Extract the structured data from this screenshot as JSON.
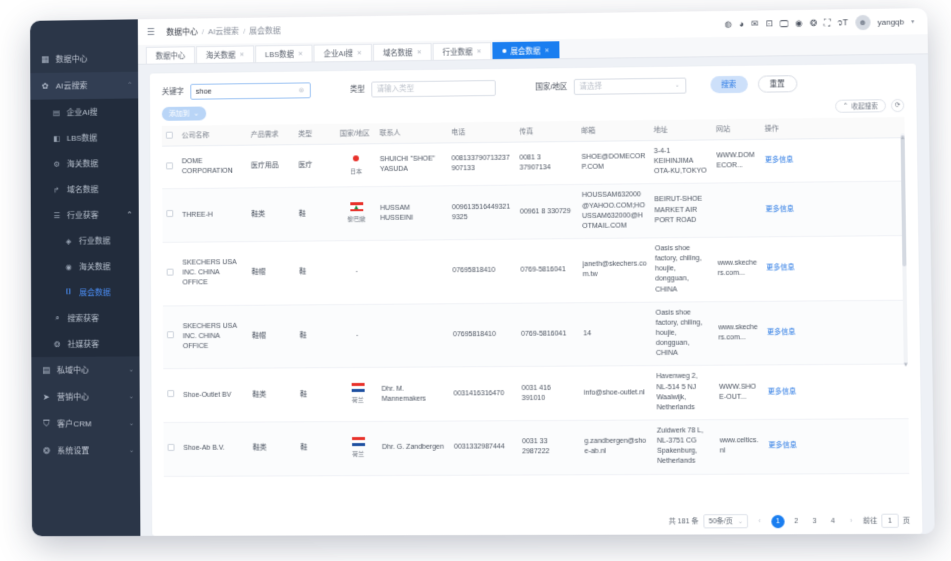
{
  "sidebar": {
    "items": [
      {
        "label": "数据中心",
        "icon": "grid-icon",
        "type": "group"
      },
      {
        "label": "AI云搜索",
        "icon": "gear-icon",
        "type": "group-open",
        "caret": "⌃"
      },
      {
        "label": "企业AI搜",
        "icon": "building-icon",
        "type": "sub"
      },
      {
        "label": "LBS数据",
        "icon": "book-icon",
        "type": "sub"
      },
      {
        "label": "海关数据",
        "icon": "customs-icon",
        "type": "sub"
      },
      {
        "label": "域名数据",
        "icon": "link-icon",
        "type": "sub"
      },
      {
        "label": "行业获客",
        "icon": "list-icon",
        "type": "sub-group-open",
        "caret": "⌃"
      },
      {
        "label": "行业数据",
        "icon": "diamond-icon",
        "type": "sub3"
      },
      {
        "label": "海关数据",
        "icon": "globe-icon",
        "type": "sub3"
      },
      {
        "label": "展会数据",
        "icon": "booth-icon",
        "type": "sub3-selected"
      },
      {
        "label": "搜索获客",
        "icon": "search-icon",
        "type": "sub"
      },
      {
        "label": "社媒获客",
        "icon": "social-icon",
        "type": "sub"
      },
      {
        "label": "私域中心",
        "icon": "stack-icon",
        "type": "group",
        "caret": "⌄"
      },
      {
        "label": "营销中心",
        "icon": "send-icon",
        "type": "group",
        "caret": "⌄"
      },
      {
        "label": "客户CRM",
        "icon": "crm-icon",
        "type": "group",
        "caret": "⌄"
      },
      {
        "label": "系统设置",
        "icon": "settings-globe-icon",
        "type": "group",
        "caret": "⌄"
      }
    ]
  },
  "topbar": {
    "collapse_icon": "menu-fold-icon",
    "breadcrumb": [
      "数据中心",
      "AI云搜索",
      "展会数据"
    ],
    "separator": "/",
    "right_icons": [
      "compass-icon",
      "chat-icon",
      "mail-icon",
      "screenshot-icon",
      "monitor-icon",
      "help-icon",
      "language-icon",
      "fullscreen-icon",
      "font-size-icon"
    ],
    "username": "yangqb",
    "user_caret": "▾"
  },
  "tabs": [
    {
      "label": "数据中心",
      "closable": false,
      "active": false
    },
    {
      "label": "海关数据",
      "closable": true,
      "active": false
    },
    {
      "label": "LBS数据",
      "closable": true,
      "active": false
    },
    {
      "label": "企业AI搜",
      "closable": true,
      "active": false
    },
    {
      "label": "域名数据",
      "closable": true,
      "active": false
    },
    {
      "label": "行业数据",
      "closable": true,
      "active": false
    },
    {
      "label": "展会数据",
      "closable": true,
      "active": true
    }
  ],
  "filters": {
    "keyword_label": "关键字",
    "keyword_value": "shoe",
    "keyword_clear": "⊗",
    "type_label": "类型",
    "type_placeholder": "请输入类型",
    "country_label": "国家/地区",
    "country_placeholder": "请选择",
    "search_button": "搜索",
    "reset_button": "重置"
  },
  "actions": {
    "add_button": "添加到",
    "add_caret": "⌄",
    "collapse_search": "收起搜索",
    "collapse_caret": "⌃",
    "refresh_icon": "refresh-icon"
  },
  "table": {
    "columns": [
      "公司名称",
      "产品需求",
      "类型",
      "国家/地区",
      "联系人",
      "电话",
      "传真",
      "邮箱",
      "地址",
      "网站",
      "操作"
    ],
    "action_label": "更多信息",
    "rows": [
      {
        "company": "DOME CORPORATION",
        "product": "医疗用品",
        "type": "医疗",
        "country": "日本",
        "flag": "jp",
        "contact": "SHUICHI \"SHOE\" YASUDA",
        "phone": "008133790713237907133",
        "fax": "0081 3 37907134",
        "email": "SHOE@DOMECORP.COM",
        "address": "3-4-1 KEIHINJIMA OTA-KU,TOKYO",
        "website": "WWW.DOMECOR..."
      },
      {
        "company": "THREE-H",
        "product": "鞋类",
        "type": "鞋",
        "country": "黎巴嫩",
        "flag": "lb",
        "contact": "HUSSAM HUSSEINI",
        "phone": "0096135164493219325",
        "fax": "00961 8 330729",
        "email": "HOUSSAM632000@YAHOO.COM;HOUSSAM632000@HOTMAIL.COM",
        "address": "BEIRUT-SHOE MARKET AIR PORT ROAD",
        "website": ""
      },
      {
        "company": "SKECHERS USA INC. CHINA OFFICE",
        "product": "鞋帽",
        "type": "鞋",
        "country": "-",
        "flag": "none",
        "contact": "",
        "phone": "07695818410",
        "fax": "0769-5816041",
        "email": "janeth@skechers.com.tw",
        "address": "Oasis shoe factory, chiling, houjie, dongguan, CHINA",
        "website": "www.skechers.com..."
      },
      {
        "company": "SKECHERS USA INC. CHINA OFFICE",
        "product": "鞋帽",
        "type": "鞋",
        "country": "-",
        "flag": "none",
        "contact": "",
        "phone": "07695818410",
        "fax": "0769-5816041",
        "email": "14",
        "address": "Oasis shoe factory, chiling, houjie, dongguan, CHINA",
        "website": "www.skechers.com..."
      },
      {
        "company": "Shoe-Outlet BV",
        "product": "鞋类",
        "type": "鞋",
        "country": "荷兰",
        "flag": "nl",
        "contact": "Dhr. M. Mannemakers",
        "phone": "0031416316470",
        "fax": "0031 416 391010",
        "email": "info@shoe-outlet.nl",
        "address": "Havenweg 2, NL-514 5 NJ Waalwijk, Netherlands",
        "website": "WWW.SHOE-OUT..."
      },
      {
        "company": "Shoe-Ab B.V.",
        "product": "鞋类",
        "type": "鞋",
        "country": "荷兰",
        "flag": "nl",
        "contact": "Dhr. G. Zandbergen",
        "phone": "0031332987444",
        "fax": "0031 33 2987222",
        "email": "g.zandbergen@shoe-ab.nl",
        "address": "Zuidwerk 78 L, NL-3751 CG Spakenburg, Netherlands",
        "website": "www.celtics.nl"
      }
    ]
  },
  "pagination": {
    "total_text": "共 181 条",
    "page_size": "50条/页",
    "page_size_caret": "⌄",
    "prev": "‹",
    "next": "›",
    "pages": [
      "1",
      "2",
      "3",
      "4"
    ],
    "active_page": "1",
    "jump_prefix": "前往",
    "jump_value": "1",
    "jump_suffix": "页"
  }
}
